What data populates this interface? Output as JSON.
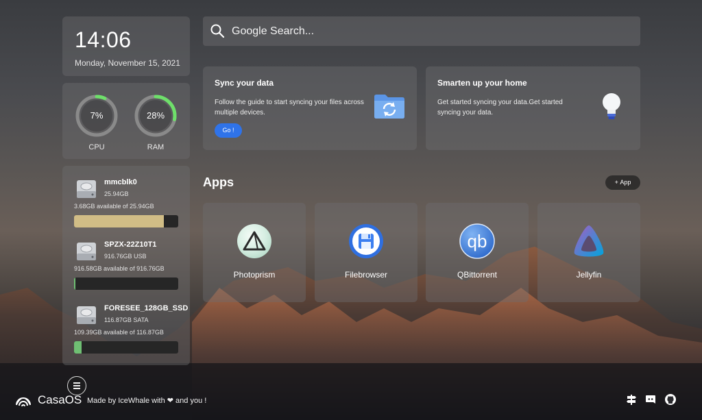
{
  "clock": {
    "time": "14:06",
    "date": "Monday, November 15, 2021"
  },
  "system": {
    "cpu": {
      "label": "CPU",
      "display": "7%",
      "fraction": 0.07
    },
    "ram": {
      "label": "RAM",
      "display": "28%",
      "fraction": 0.28
    }
  },
  "disks": [
    {
      "name": "mmcblk0",
      "size": "25.94GB",
      "available": "3.68GB available of 25.94GB",
      "used_fraction": 0.86,
      "bar_color": "#d1bd86"
    },
    {
      "name": "SPZX-22Z10T1",
      "size": "916.76GB USB",
      "available": "916.58GB available of 916.76GB",
      "used_fraction": 0.01,
      "bar_color": "#6fbf73"
    },
    {
      "name": "FORESEE_128GB_SSD",
      "size": "116.87GB SATA",
      "available": "109.39GB available of 116.87GB",
      "used_fraction": 0.07,
      "bar_color": "#6fbf73"
    }
  ],
  "search": {
    "placeholder": "Google Search...",
    "value": ""
  },
  "cards": [
    {
      "title": "Sync your data",
      "description": "Follow the guide to start syncing your files across multiple devices.",
      "button": "Go !",
      "icon": "sync-folder-icon"
    },
    {
      "title": "Smarten up your home",
      "description": "Get started syncing your data.Get started syncing your data.",
      "icon": "lightbulb-icon"
    }
  ],
  "apps_section": {
    "title": "Apps",
    "add_button": "App"
  },
  "apps": [
    {
      "name": "Photoprism",
      "icon": "photoprism-icon"
    },
    {
      "name": "Filebrowser",
      "icon": "filebrowser-icon"
    },
    {
      "name": "QBittorrent",
      "icon": "qbittorrent-icon"
    },
    {
      "name": "Jellyfin",
      "icon": "jellyfin-icon"
    }
  ],
  "footer": {
    "brand": "CasaOS",
    "credit": "Made by IceWhale with ❤ and you !",
    "icons": [
      "signpost-icon",
      "discord-icon",
      "github-icon"
    ]
  },
  "colors": {
    "accent": "#2f73e9",
    "gauge_green": "#6ee06a"
  }
}
